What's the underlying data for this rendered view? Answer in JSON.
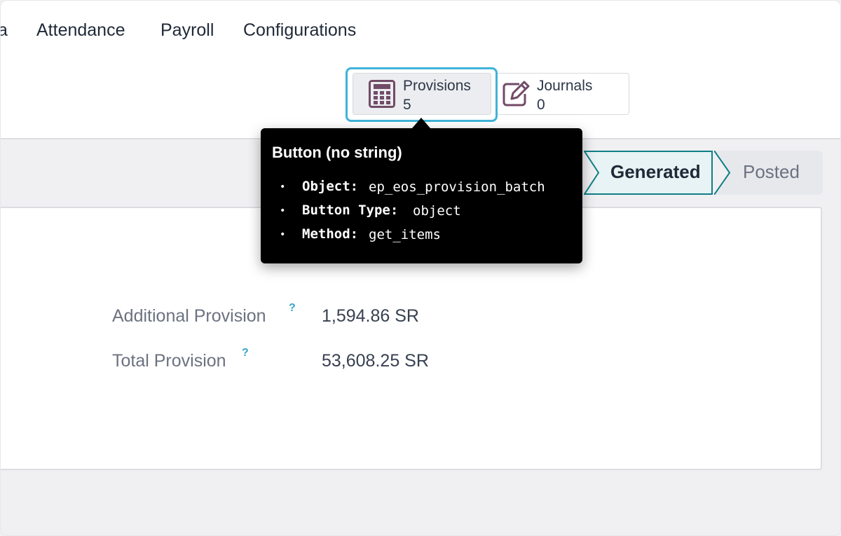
{
  "nav": {
    "items": [
      {
        "label": "a"
      },
      {
        "label": "Attendance"
      },
      {
        "label": "Payroll"
      },
      {
        "label": "Configurations"
      }
    ]
  },
  "smart_buttons": {
    "provisions": {
      "label": "Provisions",
      "count": "5",
      "icon": "calculator-icon"
    },
    "journals": {
      "label": "Journals",
      "count": "0",
      "icon": "edit-icon"
    }
  },
  "status": {
    "stages": [
      {
        "label": "Generated",
        "active": true
      },
      {
        "label": "Posted",
        "active": false
      }
    ]
  },
  "form": {
    "fields": [
      {
        "label": "Additional Provision",
        "help": "?",
        "value": "1,594.86 SR"
      },
      {
        "label": "Total Provision",
        "help": "?",
        "value": "53,608.25 SR"
      }
    ]
  },
  "tooltip": {
    "title": "Button (no string)",
    "items": [
      {
        "key": "Object:",
        "value": "ep_eos_provision_batch"
      },
      {
        "key": "Button Type:",
        "value": "object"
      },
      {
        "key": "Method:",
        "value": "get_items"
      }
    ]
  },
  "colors": {
    "focus_ring": "#3fb3d9",
    "active_stage_bg": "#e7f3f4",
    "active_stage_border": "#0f7f86",
    "icon": "#714b67",
    "help": "#3aa6c7",
    "tooltip_bg": "#000000"
  }
}
